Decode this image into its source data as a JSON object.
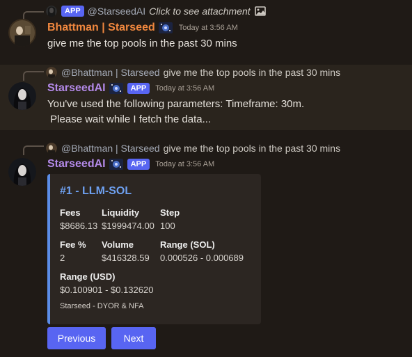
{
  "messages": [
    {
      "reply": {
        "badge": "APP",
        "mention": "@StarseedAI",
        "text": "Click to see attachment"
      },
      "author": "Bhattman | Starseed",
      "timestamp": "Today at 3:56 AM",
      "content": "give me the top pools in the past 30 mins"
    },
    {
      "reply": {
        "mention": "@Bhattman | Starseed",
        "text": "give me the top pools in the past 30 mins"
      },
      "author": "StarseedAI",
      "badge": "APP",
      "timestamp": "Today at 3:56 AM",
      "content_line1": "You've used the following parameters: Timeframe: 30m.",
      "content_line2": " Please wait while I fetch the data..."
    },
    {
      "reply": {
        "mention": "@Bhattman | Starseed",
        "text": "give me the top pools in the past 30 mins"
      },
      "author": "StarseedAI",
      "badge": "APP",
      "timestamp": "Today at 3:56 AM",
      "embed": {
        "title": "#1 - LLM-SOL",
        "fields": [
          {
            "name": "Fees",
            "value": "$8686.13"
          },
          {
            "name": "Liquidity",
            "value": "$1999474.00"
          },
          {
            "name": "Step",
            "value": "100"
          },
          {
            "name": "Fee %",
            "value": "2"
          },
          {
            "name": "Volume",
            "value": "$416328.59"
          },
          {
            "name": "Range (SOL)",
            "value": "0.000526 - 0.000689"
          },
          {
            "name": "Range (USD)",
            "value": "$0.100901 - $0.132620"
          }
        ],
        "footer": "Starseed - DYOR & NFA",
        "accent": "#5b8de8"
      },
      "buttons": {
        "previous": "Previous",
        "next": "Next"
      }
    }
  ],
  "colors": {
    "background": "#1f1a16",
    "highlight": "#2a241d",
    "button": "#5865f2"
  }
}
